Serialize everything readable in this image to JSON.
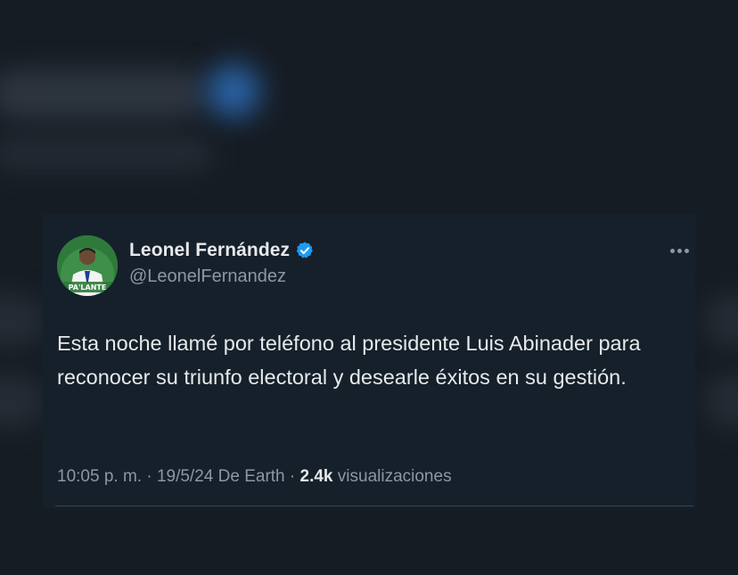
{
  "tweet": {
    "author_name": "Leonel Fernández",
    "author_handle": "@LeonelFernandez",
    "avatar_caption": "PA'LANTE",
    "text": "Esta noche llamé por teléfono al presidente Luis Abinader para reconocer su triunfo electoral y desearle éxitos en su gestión.",
    "time": "10:05 p. m.",
    "separator": "·",
    "date": "19/5/24",
    "source": "De Earth",
    "views_count": "2.4k",
    "views_label": "visualizaciones"
  },
  "icons": {
    "verified": "verified-badge-icon",
    "more": "more-options-icon"
  },
  "colors": {
    "background": "#161c24",
    "card": "#15202b",
    "text": "#e7e9ea",
    "muted": "#8b98a5",
    "verified": "#1d9bf0",
    "avatar_green": "#2f7a3a"
  }
}
